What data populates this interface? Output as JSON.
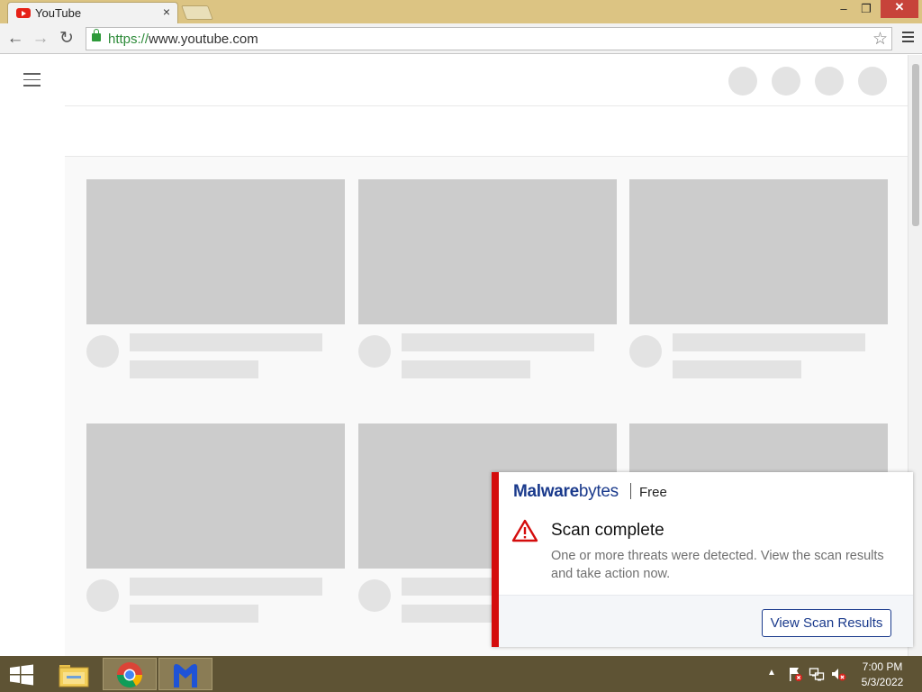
{
  "browser": {
    "tab_title": "YouTube",
    "tab_close": "×",
    "url_scheme": "https://",
    "url_rest": "www.youtube.com",
    "window_minimize": "–",
    "window_maximize": "❐",
    "window_close": "✕",
    "back_icon": "←",
    "forward_icon": "→",
    "reload_icon": "↻",
    "star_icon": "☆"
  },
  "toast": {
    "brand_bold": "Malware",
    "brand_light": "bytes",
    "edition": "Free",
    "title": "Scan complete",
    "message": "One or more threats were detected. View the scan results and take action now.",
    "button": "View Scan Results",
    "accent_color": "#d40c0c",
    "brand_color": "#1a3a8c"
  },
  "taskbar": {
    "time": "7:00 PM",
    "date": "5/3/2022",
    "tray_chevron": "▲",
    "items": [
      "file-explorer",
      "google-chrome",
      "malwarebytes"
    ]
  }
}
